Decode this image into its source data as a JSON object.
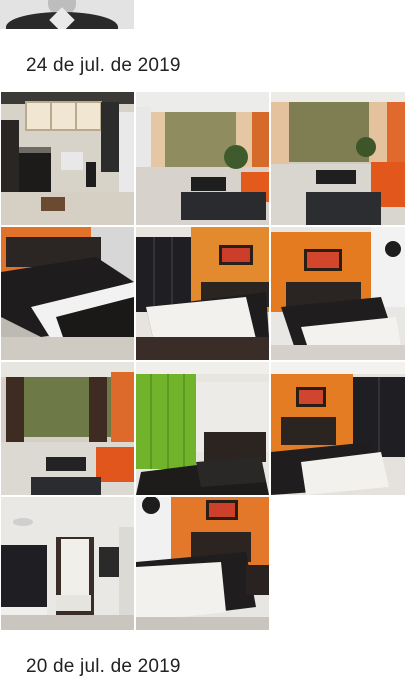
{
  "sections": [
    {
      "date": "24 de jul. de 2019"
    },
    {
      "date": "20 de jul. de 2019"
    }
  ],
  "photos": [
    {
      "subject": "kitchen"
    },
    {
      "subject": "living-room-balcony"
    },
    {
      "subject": "living-room-balcony"
    },
    {
      "subject": "bedroom"
    },
    {
      "subject": "bedroom-wardrobe"
    },
    {
      "subject": "bedroom-orange-wall"
    },
    {
      "subject": "living-room-window"
    },
    {
      "subject": "bedroom-green-curtain"
    },
    {
      "subject": "bedroom-orange-wall"
    },
    {
      "subject": "room-curtain-door"
    },
    {
      "subject": "bedroom-orange-wall"
    }
  ]
}
